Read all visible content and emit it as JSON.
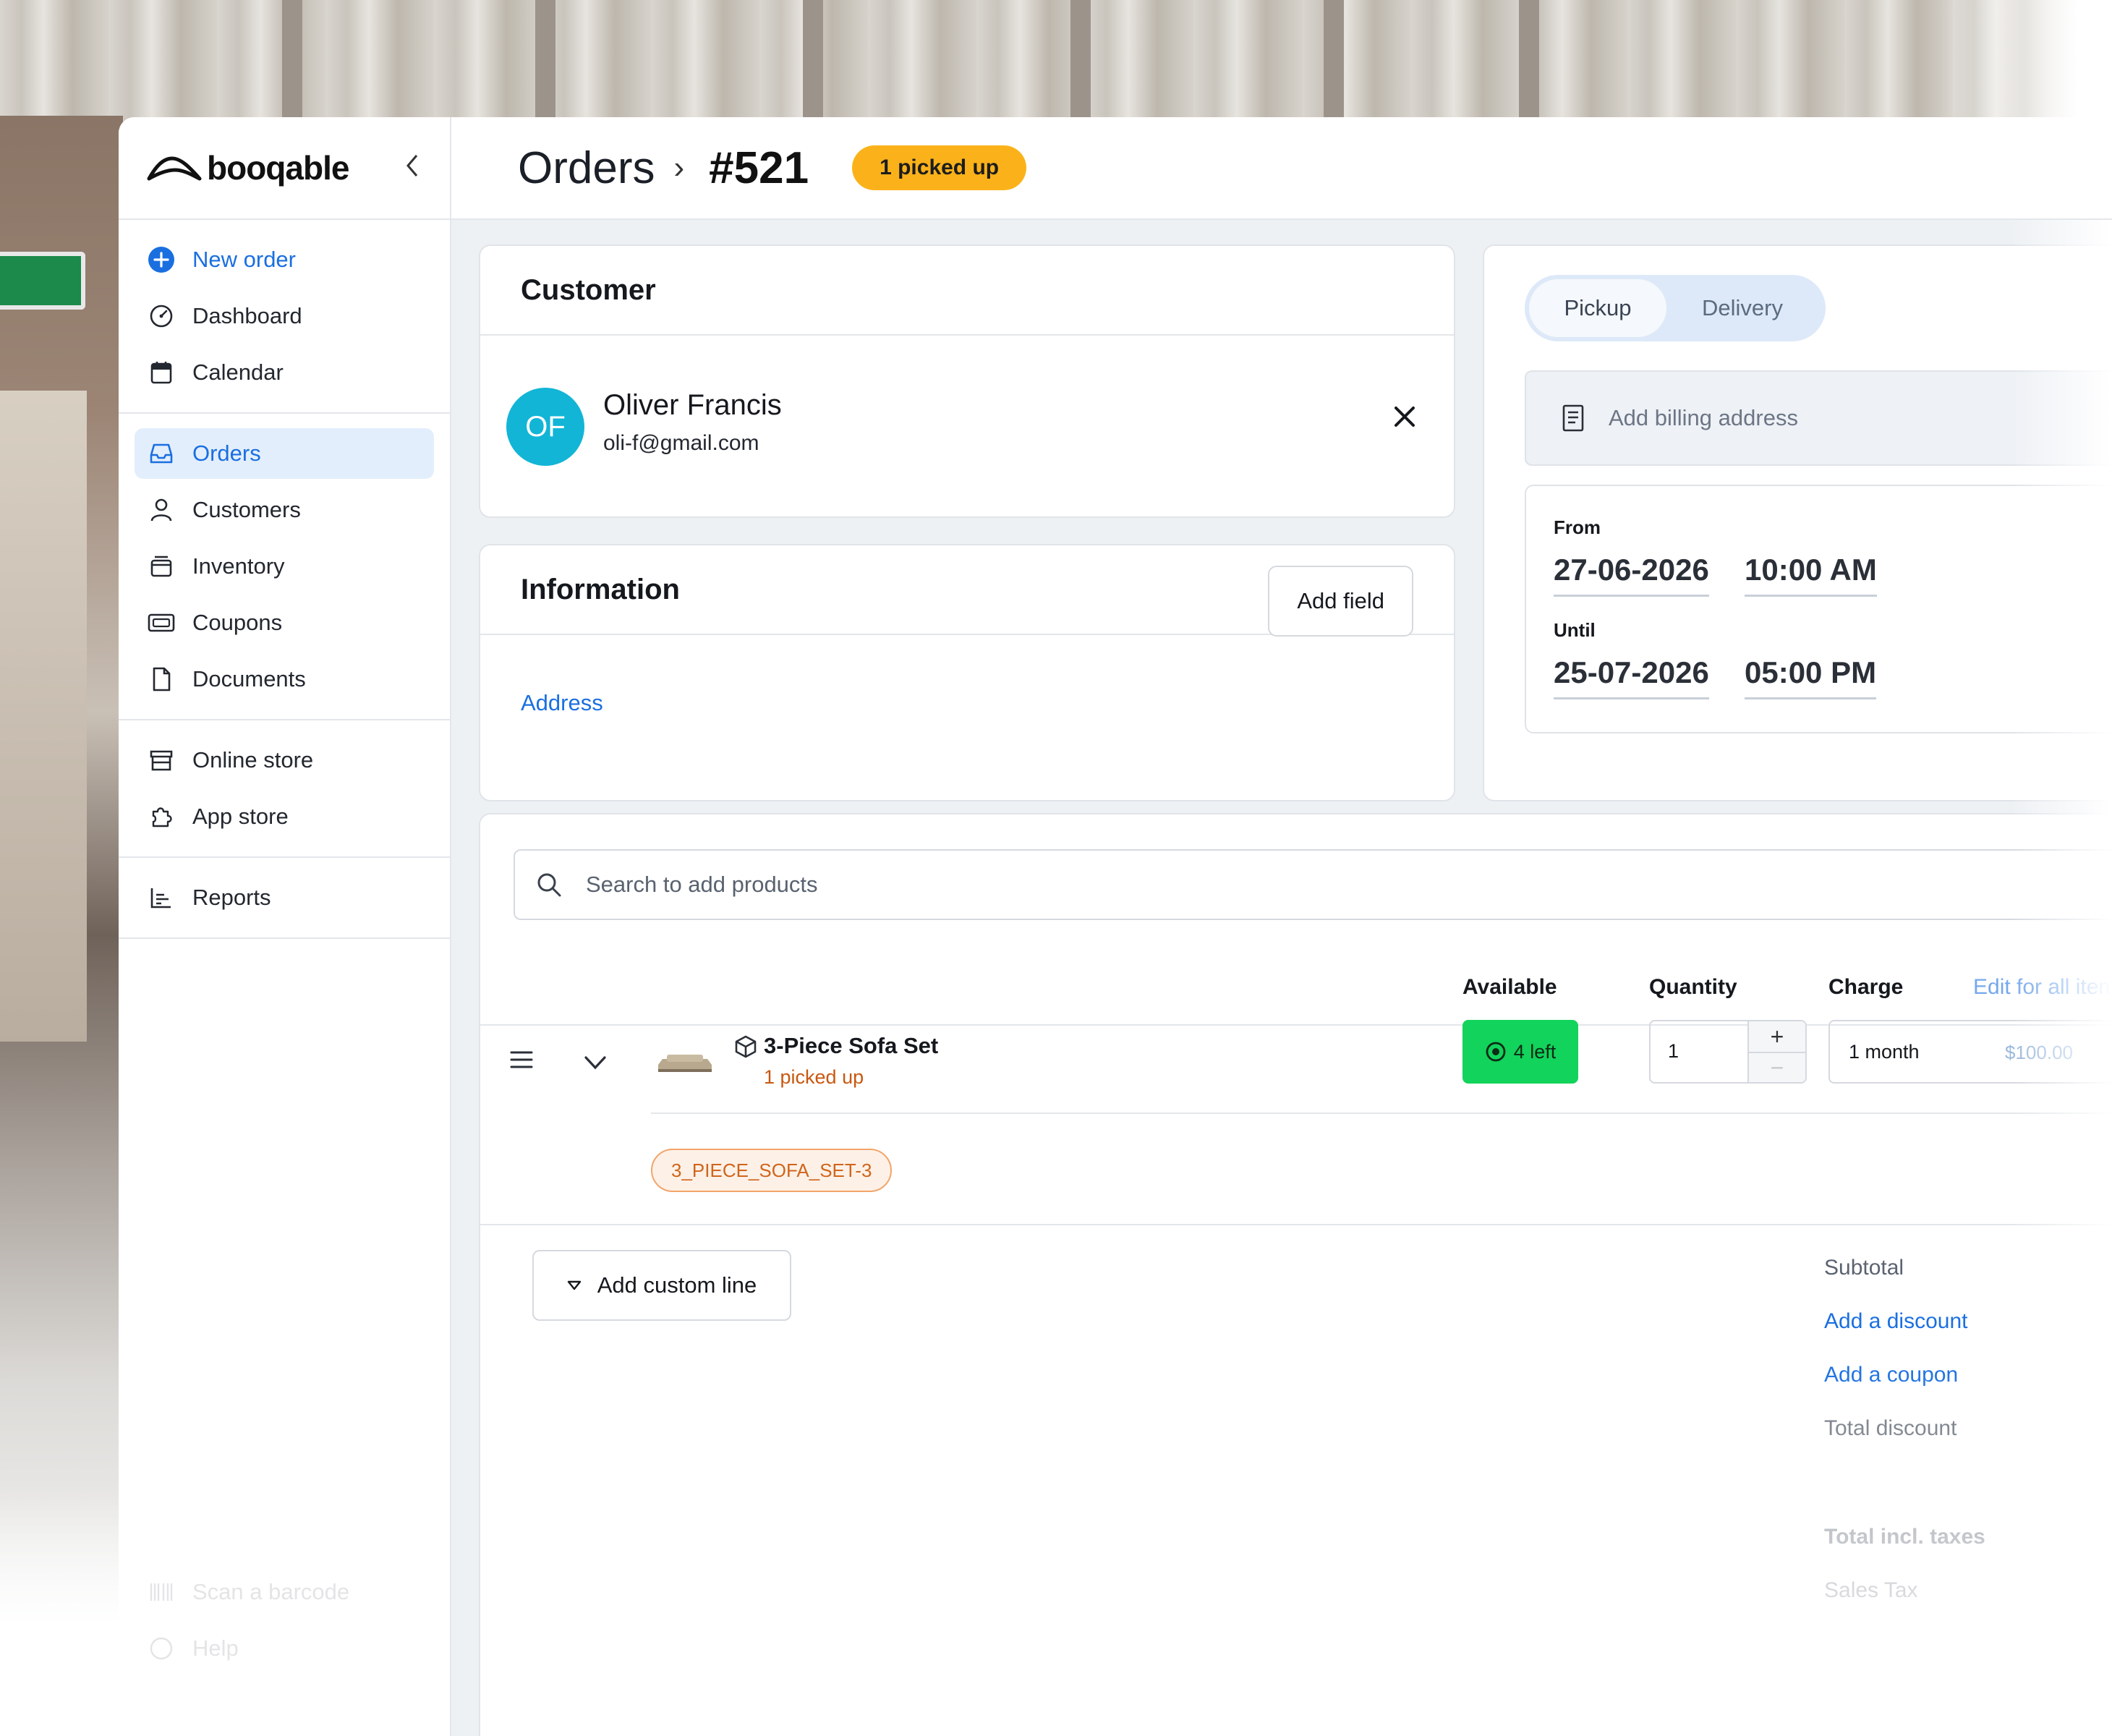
{
  "app": {
    "brand": "booqable",
    "collapse_icon": "chevron-left-icon"
  },
  "sidebar": {
    "groups": [
      [
        {
          "label": "New order",
          "icon": "plus-circle-icon"
        },
        {
          "label": "Dashboard",
          "icon": "gauge-icon"
        },
        {
          "label": "Calendar",
          "icon": "calendar-icon"
        }
      ],
      [
        {
          "label": "Orders",
          "icon": "inbox-icon",
          "active": true
        },
        {
          "label": "Customers",
          "icon": "user-icon"
        },
        {
          "label": "Inventory",
          "icon": "box-icon"
        },
        {
          "label": "Coupons",
          "icon": "ticket-icon"
        },
        {
          "label": "Documents",
          "icon": "file-icon"
        }
      ],
      [
        {
          "label": "Online store",
          "icon": "store-icon"
        },
        {
          "label": "App store",
          "icon": "puzzle-icon"
        }
      ],
      [
        {
          "label": "Reports",
          "icon": "bar-chart-icon"
        }
      ]
    ],
    "bottom": [
      {
        "label": "Scan a barcode",
        "icon": "barcode-icon"
      },
      {
        "label": "Help",
        "icon": "help-icon"
      }
    ]
  },
  "header": {
    "breadcrumb_root": "Orders",
    "breadcrumb_sep": "›",
    "order_number": "#521",
    "status": "1 picked up",
    "status_color": "#fbb21a"
  },
  "customer": {
    "title": "Customer",
    "initials": "OF",
    "name": "Oliver Francis",
    "email": "oli-f@gmail.com",
    "avatar_color": "#12b5d6"
  },
  "information": {
    "title": "Information",
    "add_field_label": "Add field",
    "address_label": "Address"
  },
  "fulfillment": {
    "options": [
      "Pickup",
      "Delivery"
    ],
    "selected": "Pickup",
    "billing_placeholder": "Add billing address",
    "from_label": "From",
    "from_date": "27-06-2026",
    "from_time": "10:00 AM",
    "until_label": "Until",
    "until_date": "25-07-2026",
    "until_time": "05:00 PM"
  },
  "products": {
    "search_placeholder": "Search to add products",
    "columns": {
      "available": "Available",
      "quantity": "Quantity",
      "charge": "Charge",
      "edit_all": "Edit for all items"
    },
    "lines": [
      {
        "name": "3-Piece Sofa Set",
        "status": "1 picked up",
        "available": "4 left",
        "quantity": "1",
        "charge_period": "1 month",
        "charge_price": "$100.00",
        "sku": "3_PIECE_SOFA_SET-3"
      }
    ],
    "add_custom_line_label": "Add custom line"
  },
  "totals": {
    "subtotal": "Subtotal",
    "add_discount": "Add a discount",
    "add_coupon": "Add a coupon",
    "total_discount": "Total discount",
    "total_incl_taxes": "Total incl. taxes",
    "sales_tax": "Sales Tax"
  },
  "colors": {
    "accent": "#1a6fe0",
    "available_badge": "#12d35b",
    "sku_tag": "#f2a56a",
    "status_text": "#c8580f"
  }
}
